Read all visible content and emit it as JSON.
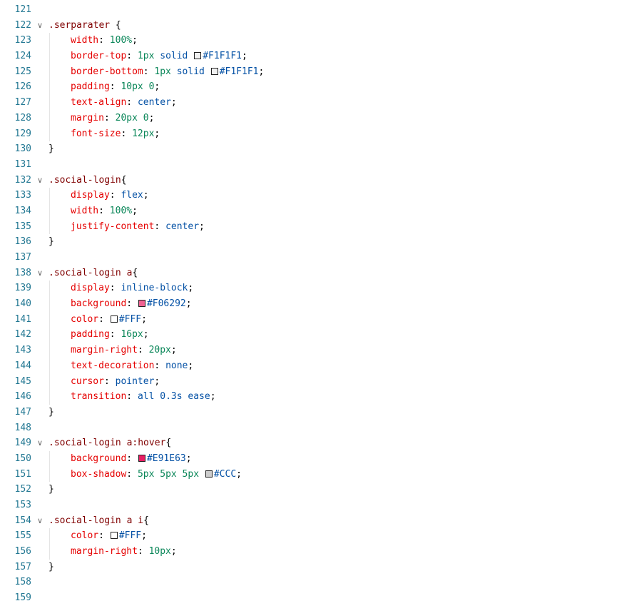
{
  "editor": {
    "colors": {
      "line_number": "#237893",
      "selector": "#800000",
      "property": "#e50000",
      "value_keyword": "#0451a5",
      "value_number": "#098658"
    },
    "lines": [
      {
        "num": "121"
      },
      {
        "num": "122",
        "fold": true,
        "selector": ".serparater",
        "open": " {"
      },
      {
        "num": "123",
        "indent": true,
        "prop": "width",
        "sep": ":",
        "val": "100%",
        "vtype": "num",
        "end": ";"
      },
      {
        "num": "124",
        "indent": true,
        "prop": "border-top",
        "sep": ":",
        "val": "1px",
        "vtype": "num",
        "val2": "solid",
        "swatch": "#F1F1F1",
        "val3": "#F1F1F1",
        "end": ";"
      },
      {
        "num": "125",
        "indent": true,
        "prop": "border-bottom",
        "sep": ":",
        "val": "1px",
        "vtype": "num",
        "val2": "solid",
        "swatch": "#F1F1F1",
        "val3": "#F1F1F1",
        "end": ";"
      },
      {
        "num": "126",
        "indent": true,
        "prop": "padding",
        "sep": ":",
        "val": "10px 0",
        "vtype": "num",
        "end": ";"
      },
      {
        "num": "127",
        "indent": true,
        "prop": "text-align",
        "sep": ":",
        "val": "center",
        "vtype": "kw",
        "end": ";"
      },
      {
        "num": "128",
        "indent": true,
        "prop": "margin",
        "sep": ":",
        "val": "20px 0",
        "vtype": "num",
        "end": ";"
      },
      {
        "num": "129",
        "indent": true,
        "prop": "font-size",
        "sep": ":",
        "val": "12px",
        "vtype": "num",
        "end": ";"
      },
      {
        "num": "130",
        "close": "}"
      },
      {
        "num": "131"
      },
      {
        "num": "132",
        "fold": true,
        "selector": ".social-login",
        "open": "{"
      },
      {
        "num": "133",
        "indent": true,
        "prop": "display",
        "sep": ":",
        "val": "flex",
        "vtype": "kw",
        "end": ";"
      },
      {
        "num": "134",
        "indent": true,
        "prop": "width",
        "sep": ":",
        "val": "100%",
        "vtype": "num",
        "end": ";"
      },
      {
        "num": "135",
        "indent": true,
        "prop": "justify-content",
        "sep": ":",
        "val": "center",
        "vtype": "kw",
        "end": ";"
      },
      {
        "num": "136",
        "close": "}"
      },
      {
        "num": "137"
      },
      {
        "num": "138",
        "fold": true,
        "selector": ".social-login a",
        "open": "{"
      },
      {
        "num": "139",
        "indent": true,
        "prop": "display",
        "sep": ":",
        "val": "inline-block",
        "vtype": "kw",
        "end": ";"
      },
      {
        "num": "140",
        "indent": true,
        "prop": "background",
        "sep": ":",
        "swatch": "#F06292",
        "val3": "#F06292",
        "end": ";"
      },
      {
        "num": "141",
        "indent": true,
        "prop": "color",
        "sep": ":",
        "swatch": "#FFFFFF",
        "val3": "#FFF",
        "end": ";"
      },
      {
        "num": "142",
        "indent": true,
        "prop": "padding",
        "sep": ":",
        "val": "16px",
        "vtype": "num",
        "end": ";"
      },
      {
        "num": "143",
        "indent": true,
        "prop": "margin-right",
        "sep": ":",
        "val": "20px",
        "vtype": "num",
        "end": ";"
      },
      {
        "num": "144",
        "indent": true,
        "prop": "text-decoration",
        "sep": ":",
        "val": "none",
        "vtype": "kw",
        "end": ";"
      },
      {
        "num": "145",
        "indent": true,
        "prop": "cursor",
        "sep": ":",
        "val": "pointer",
        "vtype": "kw",
        "end": ";"
      },
      {
        "num": "146",
        "indent": true,
        "prop": "transition",
        "sep": ":",
        "val": "all 0.3s ease",
        "vtype": "kw",
        "end": ";"
      },
      {
        "num": "147",
        "close": "}"
      },
      {
        "num": "148"
      },
      {
        "num": "149",
        "fold": true,
        "selector": ".social-login a:hover",
        "open": "{"
      },
      {
        "num": "150",
        "indent": true,
        "prop": "background",
        "sep": ":",
        "swatch": "#E91E63",
        "val3": "#E91E63",
        "end": ";"
      },
      {
        "num": "151",
        "indent": true,
        "prop": "box-shadow",
        "sep": ":",
        "val": "5px 5px 5px",
        "vtype": "num",
        "swatch": "#CCCCCC",
        "val3": "#CCC",
        "end": ";"
      },
      {
        "num": "152",
        "close": "}"
      },
      {
        "num": "153"
      },
      {
        "num": "154",
        "fold": true,
        "selector": ".social-login a i",
        "open": "{"
      },
      {
        "num": "155",
        "indent": true,
        "prop": "color",
        "sep": ":",
        "swatch": "#FFFFFF",
        "val3": "#FFF",
        "end": ";"
      },
      {
        "num": "156",
        "indent": true,
        "prop": "margin-right",
        "sep": ":",
        "val": "10px",
        "vtype": "num",
        "end": ";"
      },
      {
        "num": "157",
        "close": "}"
      },
      {
        "num": "158"
      },
      {
        "num": "159"
      }
    ]
  }
}
